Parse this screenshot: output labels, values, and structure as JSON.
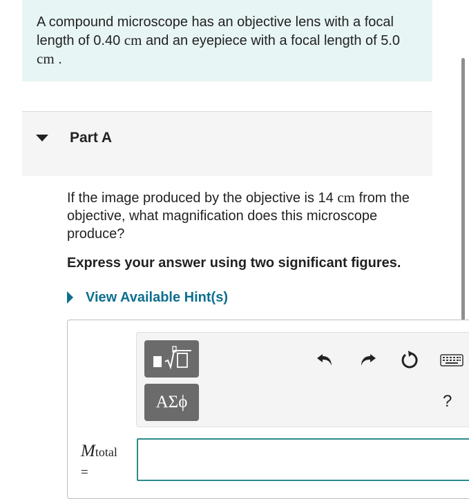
{
  "problem": {
    "text_1": "A compound microscope has an objective lens with a focal length of 0.40 ",
    "unit_1": "cm",
    "text_2": " and an eyepiece with a focal length of 5.0 ",
    "unit_2": "cm",
    "text_3": " ."
  },
  "part": {
    "title": "Part A",
    "question_1": "If the image produced by the objective is 14 ",
    "question_unit": "cm",
    "question_2": " from the objective, what magnification does this microscope produce?",
    "instruction": "Express your answer using two significant figures.",
    "hint_label": "View Available Hint(s)"
  },
  "toolbar": {
    "symbols_label": "ΑΣϕ",
    "help_label": "?"
  },
  "answer": {
    "variable": "M",
    "subscript": "total",
    "equals": "=",
    "value": ""
  },
  "colors": {
    "problem_bg": "#e7f5f4",
    "link": "#0d6f8f",
    "input_border": "#2b8a8a",
    "toolbar_button": "#6b6b6b"
  },
  "icons": [
    "caret-down-icon",
    "caret-right-icon",
    "templates-icon",
    "undo-icon",
    "redo-icon",
    "reset-icon",
    "keyboard-icon"
  ]
}
